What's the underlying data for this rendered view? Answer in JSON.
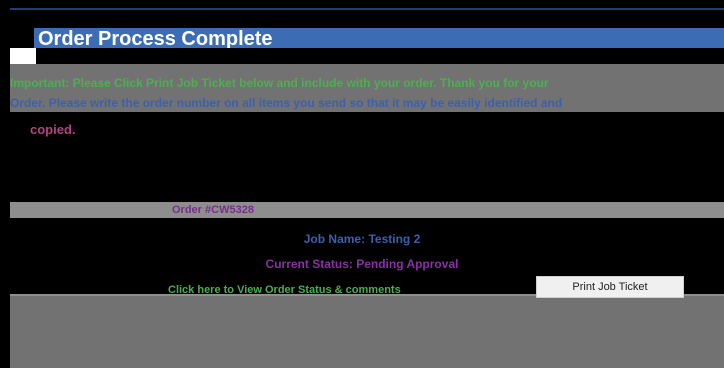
{
  "header": {
    "title": "Order Process Complete"
  },
  "message": {
    "line1": "Important: Please Click Print Job Ticket below and include with your order. Thank you for your",
    "line2": "Order. Please write the order number on all items you send so that it may be easily identified and",
    "line3": "copied."
  },
  "order": {
    "label": "Order #",
    "number": "CW5328"
  },
  "job": {
    "label": "Job Name:",
    "value": "Testing 2"
  },
  "status": {
    "label": "Current Status:",
    "value": "Pending Approval"
  },
  "actions": {
    "view_order_link": "Click here to View Order Status & comments",
    "print_button": "Print Job Ticket"
  }
}
